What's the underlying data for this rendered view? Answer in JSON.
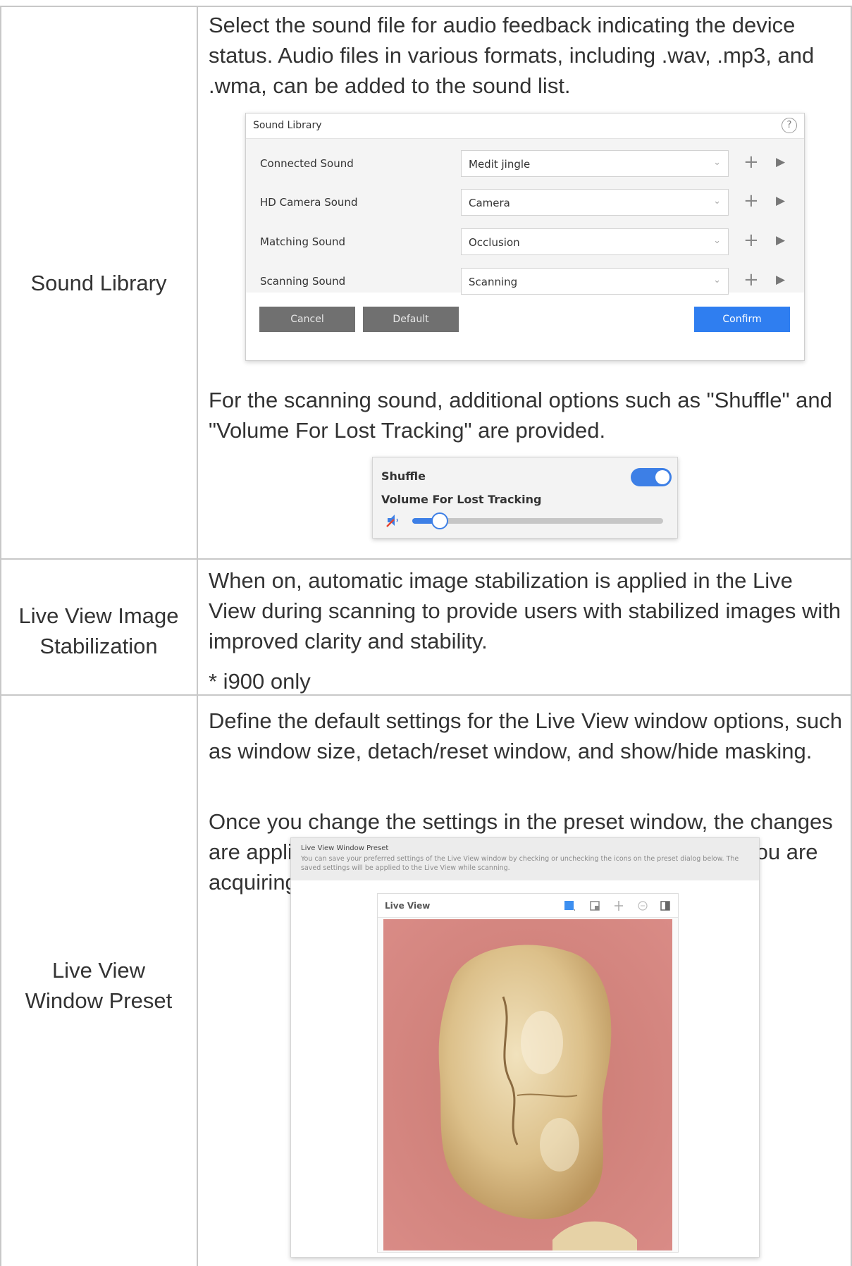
{
  "rows": {
    "sound_library": {
      "label": "Sound Library",
      "intro": "Select the sound file for audio feedback indicating the device status. Audio files in various formats, including .wav, .mp3, and .wma, can be added to the sound list.",
      "after": "For the scanning sound, additional options such as \"Shuffle\" and \"Volume For Lost Tracking\" are provided."
    },
    "stabilization": {
      "label_line1": "Live View Image",
      "label_line2": "Stabilization",
      "text": "When on, automatic image stabilization is applied in the Live View during scanning to provide users with stabilized images with improved clarity and stability.",
      "note": "* i900 only"
    },
    "preset": {
      "label_line1": "Live View",
      "label_line2": "Window Preset",
      "text1": "Define the default settings for the Live View window options, such as window size, detach/reset window, and show/hide masking.",
      "text2": "Once you change the settings in the preset window, the changes are applied to the Live View window that appears while you are acquiring the scan data."
    }
  },
  "sound_dialog": {
    "title": "Sound Library",
    "help": "?",
    "items": [
      {
        "label": "Connected Sound",
        "value": "Medit jingle"
      },
      {
        "label": "HD Camera Sound",
        "value": "Camera"
      },
      {
        "label": "Matching Sound",
        "value": "Occlusion"
      },
      {
        "label": "Scanning Sound",
        "value": "Scanning"
      }
    ],
    "cancel": "Cancel",
    "default": "Default",
    "confirm": "Confirm",
    "accent": "#2f7ef0"
  },
  "scan_options": {
    "shuffle_label": "Shuffle",
    "shuffle_on": true,
    "volume_label": "Volume For Lost Tracking",
    "volume_level": 0.11
  },
  "preset_dialog": {
    "title": "Live View Window Preset",
    "description": "You can save your preferred settings of the Live View window by checking or unchecking the icons on the preset dialog below. The saved settings will be applied to the Live View while scanning.",
    "inner_title": "Live View",
    "icons": [
      "window-size-icon",
      "detach-window-icon",
      "reset-window-icon",
      "masking-icon",
      "show-hide-icon"
    ]
  }
}
